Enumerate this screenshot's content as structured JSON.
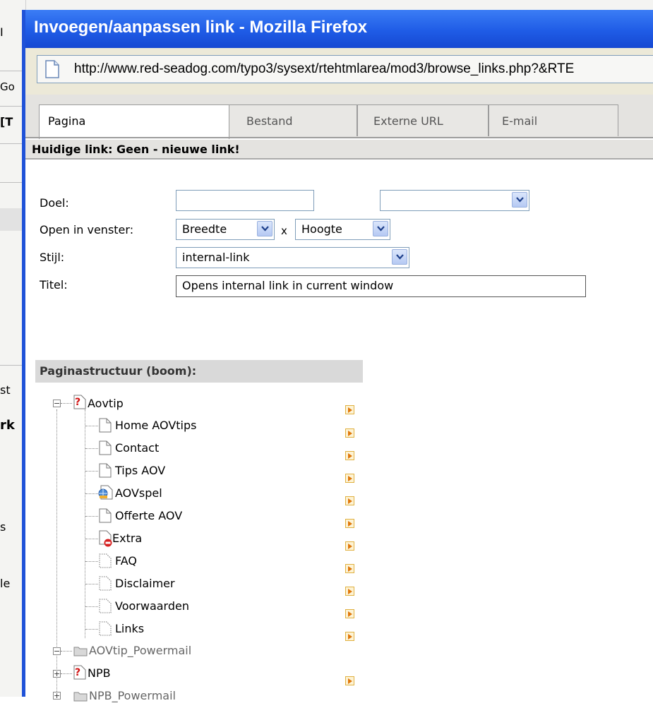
{
  "window": {
    "title": "Invoegen/aanpassen link - Mozilla Firefox",
    "url": "http://www.red-seadog.com/typo3/sysext/rtehtmlarea/mod3/browse_links.php?&RTE"
  },
  "background_fragments": [
    "I",
    "Go",
    "[T",
    "st",
    "rk",
    "s",
    "le"
  ],
  "tabs": [
    {
      "label": "Pagina",
      "active": true
    },
    {
      "label": "Bestand",
      "active": false
    },
    {
      "label": "Externe URL",
      "active": false
    },
    {
      "label": "E-mail",
      "active": false
    }
  ],
  "current_link": "Huidige link: Geen - nieuwe link!",
  "form": {
    "target_label": "Doel:",
    "target_value": "",
    "target_select": "",
    "window_label": "Open in venster:",
    "width_select": "Breedte",
    "x_sep": "x",
    "height_select": "Hoogte",
    "style_label": "Stijl:",
    "style_select": "internal-link",
    "title_label": "Titel:",
    "title_value": "Opens internal link in current window"
  },
  "tree": {
    "header": "Paginastructuur (boom):",
    "root": "Aovtip",
    "children": [
      {
        "label": "Home AOVtips",
        "icon": "page-icon"
      },
      {
        "label": "Contact",
        "icon": "page-icon"
      },
      {
        "label": "Tips AOV",
        "icon": "page-icon"
      },
      {
        "label": "AOVspel",
        "icon": "globe-page-icon"
      },
      {
        "label": "Offerte AOV",
        "icon": "page-icon"
      },
      {
        "label": "Extra",
        "icon": "hidden-page-icon"
      },
      {
        "label": "FAQ",
        "icon": "dotted-page-icon"
      },
      {
        "label": "Disclaimer",
        "icon": "dotted-page-icon"
      },
      {
        "label": "Voorwaarden",
        "icon": "dotted-page-icon"
      },
      {
        "label": "Links",
        "icon": "dotted-page-icon"
      }
    ],
    "folders": [
      {
        "label": "AOVtip_Powermail",
        "icon": "folder-icon"
      },
      {
        "label": "NPB",
        "icon": "question-page-icon"
      },
      {
        "label": "NPB_Powermail",
        "icon": "folder-icon"
      }
    ]
  },
  "colors": {
    "titlebar": "#1f5ce6",
    "tab_bg": "#e4e3e0",
    "border": "#7f9db9"
  }
}
